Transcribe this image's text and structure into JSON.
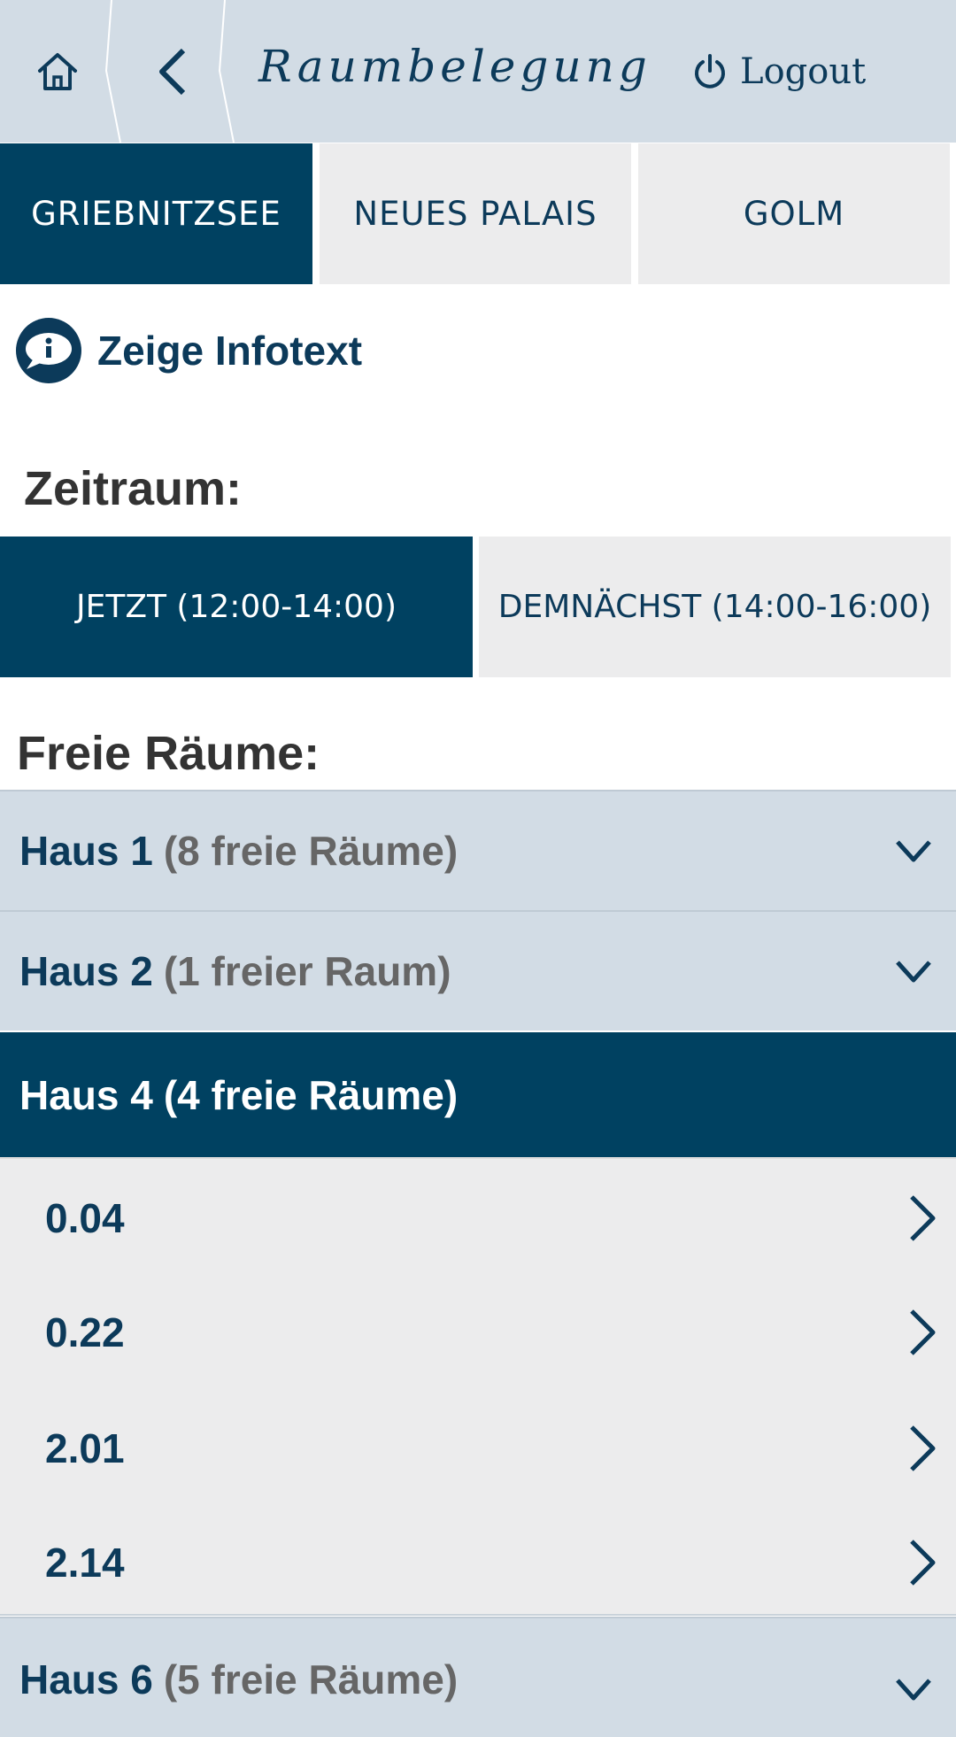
{
  "header": {
    "title": "Raumbelegung",
    "logout_label": "Logout",
    "home_icon": "home-icon",
    "back_icon": "chevron-left-icon",
    "logout_icon": "power-icon"
  },
  "campus_tabs": [
    {
      "label": "GRIEBNITZSEE",
      "active": true
    },
    {
      "label": "NEUES PALAIS",
      "active": false
    },
    {
      "label": "GOLM",
      "active": false
    }
  ],
  "info": {
    "label": "Zeige Infotext",
    "icon": "info-speech-bubble-icon"
  },
  "zeitraum": {
    "heading": "Zeitraum:",
    "options": [
      {
        "label": "JETZT (12:00-14:00)",
        "active": true
      },
      {
        "label": "DEMNÄCHST (14:00-16:00)",
        "active": false
      }
    ]
  },
  "free_rooms": {
    "heading": "Freie Räume:",
    "buildings": [
      {
        "name": "Haus 1",
        "count": "(8 freie Räume)",
        "expanded": false
      },
      {
        "name": "Haus 2",
        "count": "(1 freier Raum)",
        "expanded": false
      },
      {
        "name": "Haus 4",
        "count": "(4 freie Räume)",
        "expanded": true,
        "rooms": [
          "0.04",
          "0.22",
          "2.01",
          "2.14"
        ]
      },
      {
        "name": "Haus 6",
        "count": "(5 freie Räume)",
        "expanded": false
      }
    ]
  },
  "colors": {
    "primary": "#004161",
    "header_bg": "#d2dce5",
    "inactive_bg": "#ececed",
    "text_dark": "#0c3a5a"
  }
}
